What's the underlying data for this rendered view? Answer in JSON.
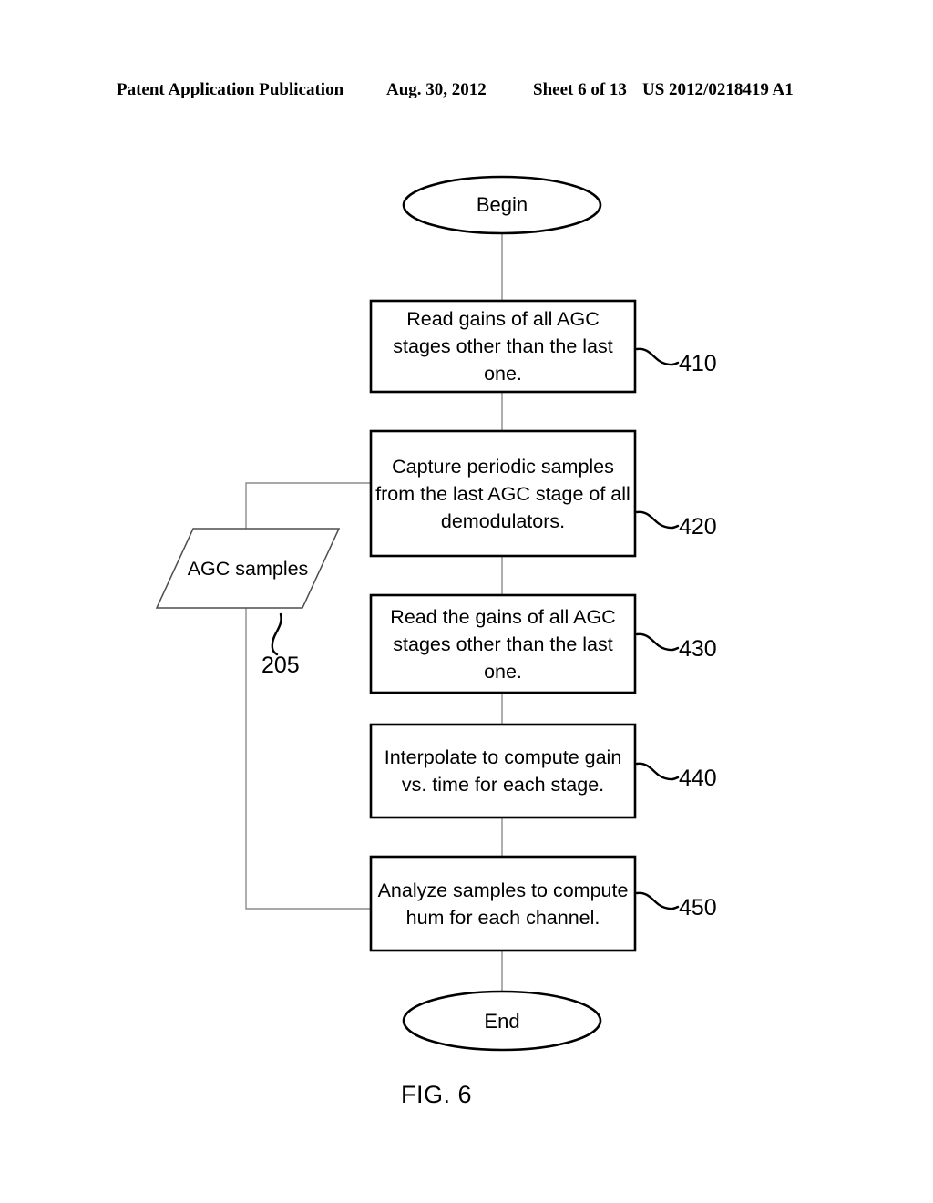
{
  "header": {
    "publication": "Patent Application Publication",
    "date": "Aug. 30, 2012",
    "sheet": "Sheet 6 of 13",
    "patent_number": "US 2012/0218419 A1"
  },
  "figure": {
    "caption": "FIG. 6",
    "type": "flowchart",
    "nodes": [
      {
        "id": "begin",
        "shape": "ellipse",
        "label": "Begin",
        "ref": ""
      },
      {
        "id": "step410",
        "shape": "process",
        "label": "Read gains of all AGC stages other than the last one.",
        "ref": "410"
      },
      {
        "id": "step420",
        "shape": "process",
        "label": "Capture periodic samples from the last AGC stage of all demodulators.",
        "ref": "420"
      },
      {
        "id": "data205",
        "shape": "parallelogram",
        "label": "AGC samples",
        "ref": "205"
      },
      {
        "id": "step430",
        "shape": "process",
        "label": "Read the gains of all AGC stages other than the last one.",
        "ref": "430"
      },
      {
        "id": "step440",
        "shape": "process",
        "label": "Interpolate to compute gain vs. time for each stage.",
        "ref": "440"
      },
      {
        "id": "step450",
        "shape": "process",
        "label": "Analyze samples to compute hum for each channel.",
        "ref": "450"
      },
      {
        "id": "end",
        "shape": "ellipse",
        "label": "End",
        "ref": ""
      }
    ],
    "edges": [
      {
        "from": "begin",
        "to": "step410"
      },
      {
        "from": "step410",
        "to": "step420"
      },
      {
        "from": "step420",
        "to": "step430"
      },
      {
        "from": "step430",
        "to": "step440"
      },
      {
        "from": "step440",
        "to": "step450"
      },
      {
        "from": "step450",
        "to": "end"
      },
      {
        "from": "step420",
        "to": "data205"
      },
      {
        "from": "data205",
        "to": "step450"
      }
    ],
    "colors": {
      "ink": "#000000",
      "connector": "#8c8c8c",
      "background": "#ffffff"
    }
  }
}
